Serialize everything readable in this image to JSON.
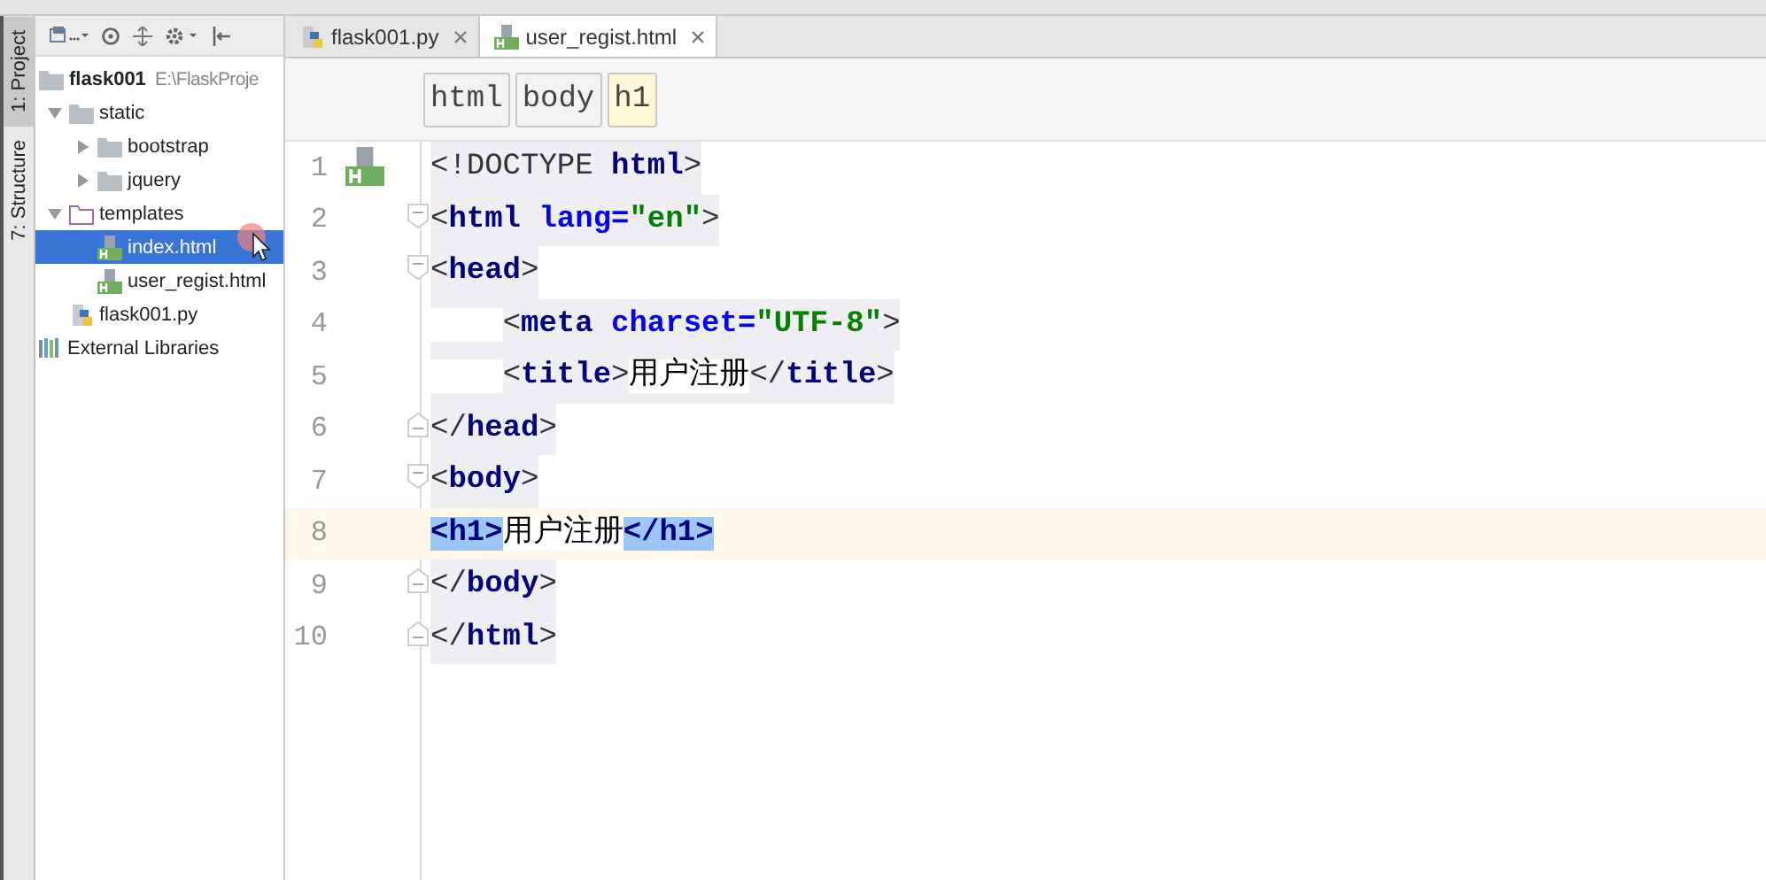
{
  "side_strip": {
    "tabs": [
      {
        "label": "1: Project",
        "selected": true
      },
      {
        "label": "7: Structure",
        "selected": false
      }
    ]
  },
  "project": {
    "root": {
      "name": "flask001",
      "path": "E:\\FlaskProje"
    },
    "tree": [
      {
        "name": "static",
        "kind": "folder",
        "expanded": true,
        "selected": false,
        "children": [
          {
            "name": "bootstrap",
            "kind": "folder",
            "expanded": false,
            "selected": false
          },
          {
            "name": "jquery",
            "kind": "folder",
            "expanded": false,
            "selected": false
          }
        ]
      },
      {
        "name": "templates",
        "kind": "template-folder",
        "expanded": true,
        "selected": false,
        "children": [
          {
            "name": "index.html",
            "kind": "html",
            "selected": true
          },
          {
            "name": "user_regist.html",
            "kind": "html",
            "selected": false
          }
        ]
      },
      {
        "name": "flask001.py",
        "kind": "python",
        "selected": false
      }
    ],
    "external": "External Libraries"
  },
  "editor": {
    "tabs": [
      {
        "label": "flask001.py",
        "kind": "python",
        "selected": false
      },
      {
        "label": "user_regist.html",
        "kind": "html",
        "selected": true
      }
    ],
    "breadcrumb": [
      {
        "label": "html",
        "selected": false
      },
      {
        "label": "body",
        "selected": false
      },
      {
        "label": "h1",
        "selected": true
      }
    ],
    "lines": [
      {
        "number": "1",
        "kind": "plain",
        "current": false,
        "tokens": [
          {
            "text": "<!DOCTYPE ",
            "kind": "bracket"
          },
          {
            "text": "html",
            "kind": "tag"
          },
          {
            "text": ">",
            "kind": "bracket"
          }
        ]
      },
      {
        "number": "2",
        "kind": "fold-start",
        "current": false,
        "tokens": [
          {
            "text": "<",
            "kind": "bracket"
          },
          {
            "text": "html ",
            "kind": "tag"
          },
          {
            "text": "lang=",
            "kind": "attr"
          },
          {
            "text": "\"en\"",
            "kind": "string"
          },
          {
            "text": ">",
            "kind": "bracket"
          }
        ]
      },
      {
        "number": "3",
        "kind": "fold-start",
        "current": false,
        "tokens": [
          {
            "text": "<",
            "kind": "bracket"
          },
          {
            "text": "head",
            "kind": "tag"
          },
          {
            "text": ">",
            "kind": "bracket"
          }
        ]
      },
      {
        "number": "4",
        "kind": "plain",
        "current": false,
        "tokens": [
          {
            "text": "    <",
            "kind": "bracket"
          },
          {
            "text": "meta ",
            "kind": "tag"
          },
          {
            "text": "charset=",
            "kind": "attr"
          },
          {
            "text": "\"UTF-8\"",
            "kind": "string"
          },
          {
            "text": ">",
            "kind": "bracket"
          }
        ]
      },
      {
        "number": "5",
        "kind": "plain",
        "current": false,
        "tokens": [
          {
            "text": "    <",
            "kind": "bracket"
          },
          {
            "text": "title",
            "kind": "tag"
          },
          {
            "text": ">",
            "kind": "bracket"
          },
          {
            "text": "用户注册",
            "kind": "text"
          },
          {
            "text": "</",
            "kind": "bracket"
          },
          {
            "text": "title",
            "kind": "tag"
          },
          {
            "text": ">",
            "kind": "bracket"
          }
        ]
      },
      {
        "number": "6",
        "kind": "fold-end",
        "current": false,
        "tokens": [
          {
            "text": "</",
            "kind": "bracket"
          },
          {
            "text": "head",
            "kind": "tag"
          },
          {
            "text": ">",
            "kind": "bracket"
          }
        ]
      },
      {
        "number": "7",
        "kind": "fold-start",
        "current": false,
        "tokens": [
          {
            "text": "<",
            "kind": "bracket"
          },
          {
            "text": "body",
            "kind": "tag"
          },
          {
            "text": ">",
            "kind": "bracket"
          }
        ]
      },
      {
        "number": "8",
        "kind": "plain",
        "current": true,
        "tokens": [
          {
            "text": "<h1>",
            "kind": "match-tag"
          },
          {
            "text": "用户注册",
            "kind": "text"
          },
          {
            "text": "</h1>",
            "kind": "match-tag"
          }
        ]
      },
      {
        "number": "9",
        "kind": "fold-end",
        "current": false,
        "tokens": [
          {
            "text": "</",
            "kind": "bracket"
          },
          {
            "text": "body",
            "kind": "tag"
          },
          {
            "text": ">",
            "kind": "bracket"
          }
        ]
      },
      {
        "number": "10",
        "kind": "fold-end",
        "current": false,
        "tokens": [
          {
            "text": "</",
            "kind": "bracket"
          },
          {
            "text": "html",
            "kind": "tag"
          },
          {
            "text": ">",
            "kind": "bracket"
          }
        ]
      }
    ]
  }
}
